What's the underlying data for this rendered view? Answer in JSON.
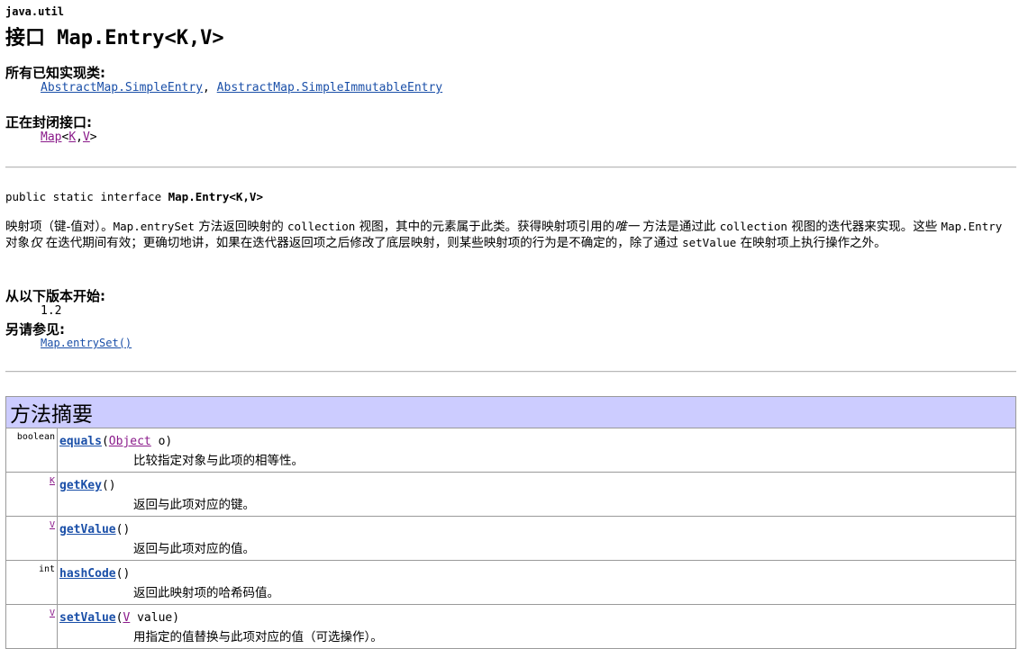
{
  "page": {
    "package": "java.util",
    "title": "接口 Map.Entry<K,V>"
  },
  "known_impl": {
    "label": "所有已知实现类:",
    "link1": "AbstractMap.SimpleEntry",
    "sep": ",",
    "link2": "AbstractMap.SimpleImmutableEntry"
  },
  "enclosing": {
    "label": "正在封闭接口:",
    "map": "Map",
    "lt": "<",
    "k": "K",
    "comma": ",",
    "v": "V",
    "gt": ">"
  },
  "declaration": {
    "prefix": "public static interface ",
    "name": "Map.Entry<K,V>"
  },
  "description": {
    "p1": "映射项（键-值对）。",
    "c1": "Map.entrySet",
    "p2": " 方法返回映射的 ",
    "c2": "collection",
    "p3": " 视图，其中的元素属于此类。获得映射项引用的",
    "em1": "唯一",
    "p4": " 方法是通过此 ",
    "c3": "collection",
    "p5": " 视图的迭代器来实现。这些 ",
    "c4": "Map.Entry",
    "p6": " 对象",
    "em2": "仅",
    "p7": " 在迭代期间有效；更确切地讲，如果在迭代器返回项之后修改了底层映射，则某些映射项的行为是不确定的，除了通过 ",
    "c5": "setValue",
    "p8": " 在映射项上执行操作之外。"
  },
  "since": {
    "label": "从以下版本开始:",
    "value": "1.2"
  },
  "see_also": {
    "label": "另请参见:",
    "link": "Map.entrySet()"
  },
  "summary": {
    "header": "方法摘要",
    "methods": [
      {
        "ret": "boolean",
        "name": "equals",
        "open": "(",
        "ptype": "Object",
        "pname": " o",
        "close": ")",
        "desc": "比较指定对象与此项的相等性。"
      },
      {
        "ret": "K",
        "name": "getKey",
        "open": "(",
        "ptype": "",
        "pname": "",
        "close": ")",
        "desc": "返回与此项对应的键。"
      },
      {
        "ret": "V",
        "name": "getValue",
        "open": "(",
        "ptype": "",
        "pname": "",
        "close": ")",
        "desc": "返回与此项对应的值。"
      },
      {
        "ret": "int",
        "name": "hashCode",
        "open": "(",
        "ptype": "",
        "pname": "",
        "close": ")",
        "desc": "返回此映射项的哈希码值。"
      },
      {
        "ret": "V",
        "name": "setValue",
        "open": "(",
        "ptype": "V",
        "pname": " value",
        "close": ")",
        "desc": "用指定的值替换与此项对应的值（可选操作）。"
      }
    ]
  },
  "colors": {
    "link": "#1a4fa8",
    "visited_link": "#8a1a8a",
    "summary_header_bg": "#ccccff",
    "border": "#9a9a9a"
  }
}
